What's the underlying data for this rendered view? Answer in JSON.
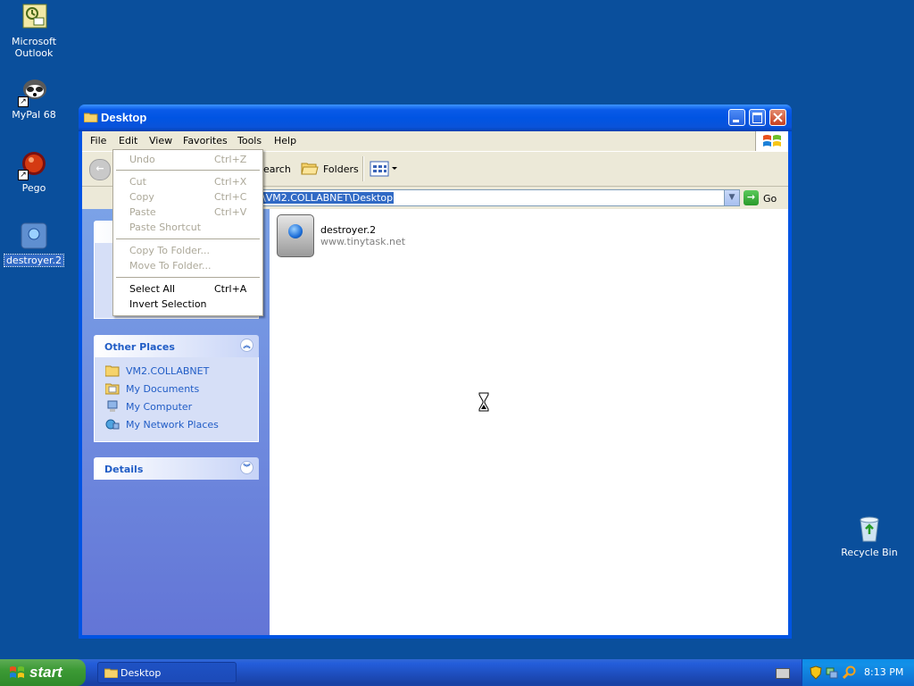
{
  "desktop": {
    "icons": [
      {
        "label": "Microsoft\nOutlook"
      },
      {
        "label": "MyPal 68"
      },
      {
        "label": "Pego"
      },
      {
        "label": "destroyer.2"
      },
      {
        "label": "Recycle Bin"
      }
    ]
  },
  "window": {
    "title": "Desktop",
    "menu": [
      "File",
      "Edit",
      "View",
      "Favorites",
      "Tools",
      "Help"
    ],
    "toolbar": {
      "search_label": "Search",
      "folders_label": "Folders"
    },
    "address": {
      "value": "\\VM2.COLLABNET\\Desktop",
      "go_label": "Go"
    },
    "other_places": {
      "title": "Other Places",
      "links": [
        "VM2.COLLABNET",
        "My Documents",
        "My Computer",
        "My Network Places"
      ]
    },
    "details": {
      "title": "Details"
    },
    "file": {
      "name": "destroyer.2",
      "subtitle": "www.tinytask.net"
    }
  },
  "edit_menu": {
    "items": [
      {
        "label": "Undo",
        "shortcut": "Ctrl+Z",
        "enabled": false
      },
      {
        "label": "Cut",
        "shortcut": "Ctrl+X",
        "enabled": false
      },
      {
        "label": "Copy",
        "shortcut": "Ctrl+C",
        "enabled": false
      },
      {
        "label": "Paste",
        "shortcut": "Ctrl+V",
        "enabled": false
      },
      {
        "label": "Paste Shortcut",
        "shortcut": "",
        "enabled": false
      },
      {
        "label": "Copy To Folder...",
        "shortcut": "",
        "enabled": false
      },
      {
        "label": "Move To Folder...",
        "shortcut": "",
        "enabled": false
      },
      {
        "label": "Select All",
        "shortcut": "Ctrl+A",
        "enabled": true
      },
      {
        "label": "Invert Selection",
        "shortcut": "",
        "enabled": true
      }
    ]
  },
  "taskbar": {
    "start_label": "start",
    "task_label": "Desktop",
    "clock": "8:13 PM"
  }
}
